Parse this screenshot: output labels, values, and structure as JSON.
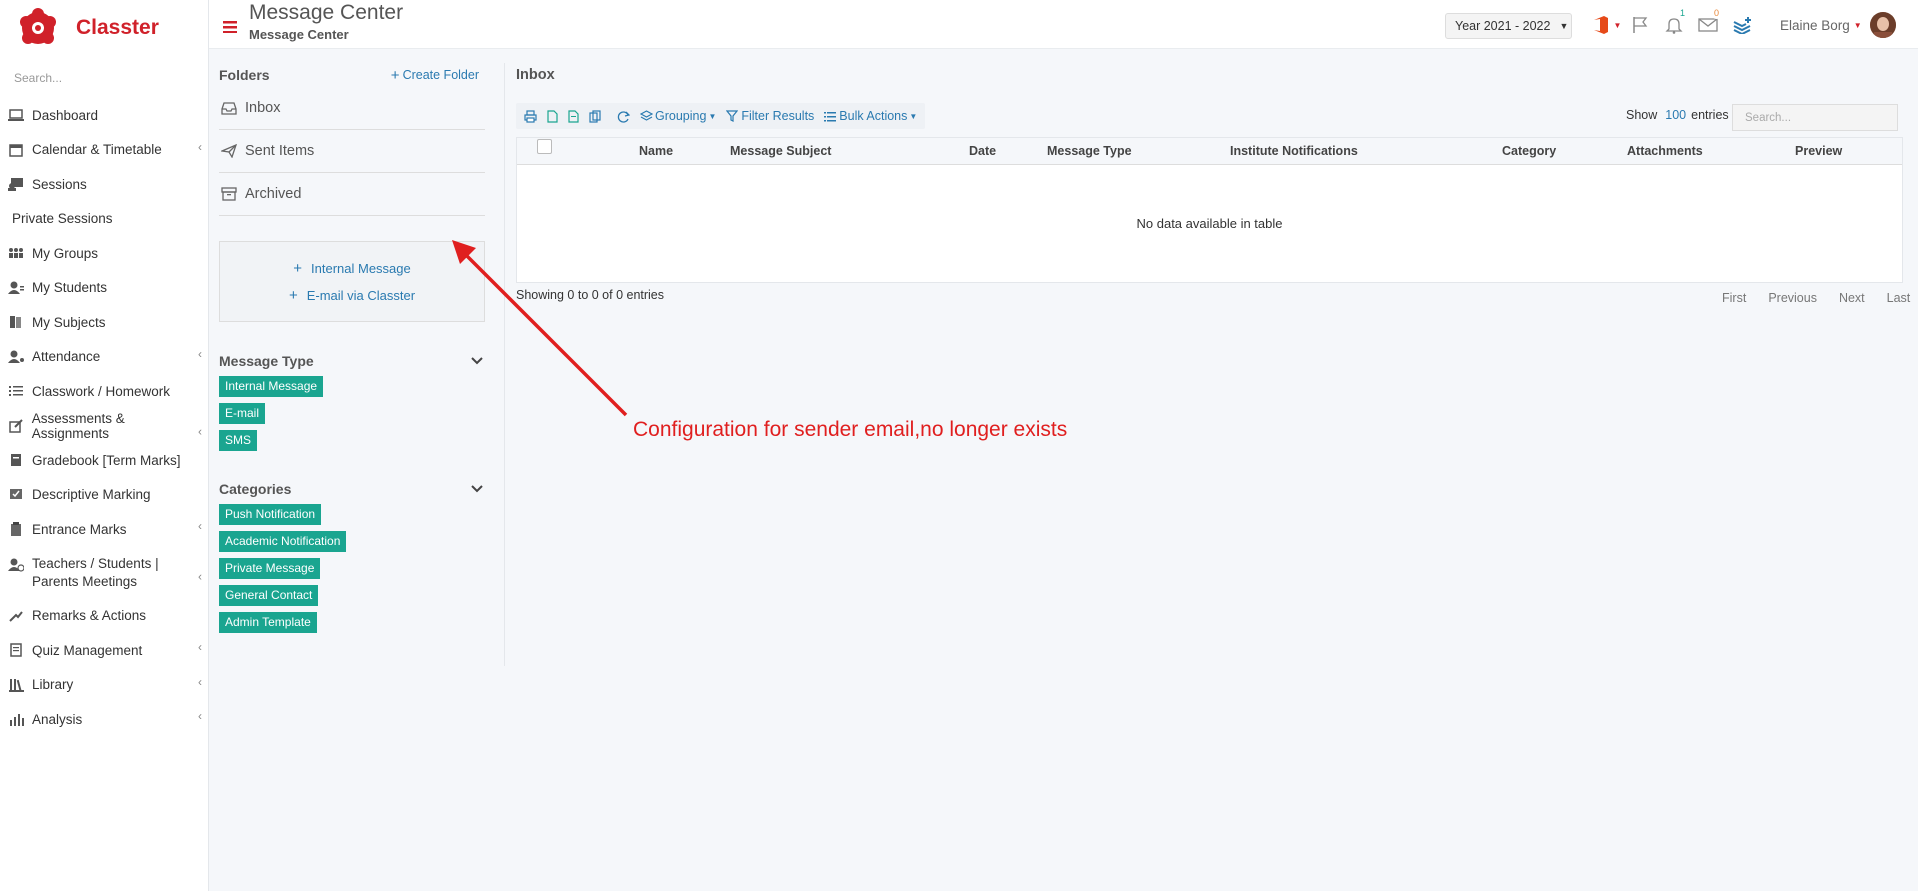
{
  "app": {
    "name": "Classter"
  },
  "sidebar": {
    "search_placeholder": "Search...",
    "items": [
      {
        "label": "Dashboard",
        "icon": "laptop-icon",
        "caret": false
      },
      {
        "label": "Calendar & Timetable",
        "icon": "calendar-icon",
        "caret": true
      },
      {
        "label": "Sessions",
        "icon": "sessions-icon",
        "caret": false
      },
      {
        "label": "Private Sessions",
        "icon": "",
        "caret": false
      },
      {
        "label": "My Groups",
        "icon": "groups-icon",
        "caret": false
      },
      {
        "label": "My Students",
        "icon": "students-icon",
        "caret": false
      },
      {
        "label": "My Subjects",
        "icon": "book-icon",
        "caret": false
      },
      {
        "label": "Attendance",
        "icon": "attendance-icon",
        "caret": true
      },
      {
        "label": "Classwork / Homework",
        "icon": "list-icon",
        "caret": false
      },
      {
        "label": "Assessments & Assignments",
        "icon": "edit-icon",
        "caret": true
      },
      {
        "label": "Gradebook [Term Marks]",
        "icon": "gradebook-icon",
        "caret": false
      },
      {
        "label": "Descriptive Marking",
        "icon": "marking-icon",
        "caret": false
      },
      {
        "label": "Entrance Marks",
        "icon": "clipboard-icon",
        "caret": true
      },
      {
        "label": "Teachers / Students | Parents Meetings",
        "icon": "meetings-icon",
        "caret": true
      },
      {
        "label": "Remarks & Actions",
        "icon": "remarks-icon",
        "caret": false
      },
      {
        "label": "Quiz Management",
        "icon": "quiz-icon",
        "caret": true
      },
      {
        "label": "Library",
        "icon": "library-icon",
        "caret": true
      },
      {
        "label": "Analysis",
        "icon": "analysis-icon",
        "caret": true
      }
    ]
  },
  "header": {
    "title": "Message Center",
    "subtitle": "Message Center",
    "year": "Year 2021 - 2022",
    "notifications_badge": "1",
    "messages_badge": "0",
    "user_name": "Elaine Borg"
  },
  "folders": {
    "title": "Folders",
    "create_label": "Create Folder",
    "items": [
      {
        "label": "Inbox",
        "icon": "inbox-icon"
      },
      {
        "label": "Sent Items",
        "icon": "send-icon"
      },
      {
        "label": "Archived",
        "icon": "archive-icon"
      }
    ],
    "compose": {
      "internal": "Internal Message",
      "email": "E-mail via Classter"
    }
  },
  "message_type": {
    "title": "Message Type",
    "tags": [
      "Internal Message",
      "E-mail",
      "SMS"
    ]
  },
  "categories": {
    "title": "Categories",
    "tags": [
      "Push Notification",
      "Academic Notification",
      "Private Message",
      "General Contact",
      "Admin Template"
    ]
  },
  "inbox": {
    "title": "Inbox",
    "toolbar": {
      "grouping": "Grouping",
      "filter": "Filter Results",
      "bulk": "Bulk Actions"
    },
    "show_label": "Show",
    "page_size": "100",
    "entries_label": "entries",
    "search_placeholder": "Search...",
    "columns": [
      "Name",
      "Message Subject",
      "Date",
      "Message Type",
      "Institute Notifications",
      "Category",
      "Attachments",
      "Preview"
    ],
    "empty_text": "No data available in table",
    "showing_text": "Showing 0 to 0 of 0 entries",
    "pager": [
      "First",
      "Previous",
      "Next",
      "Last"
    ]
  },
  "annotation": {
    "text": "Configuration for sender email,no longer exists",
    "color": "#e01f1f"
  },
  "colors": {
    "brand": "#d0212a",
    "link": "#2a7ab0",
    "tag": "#1aa590"
  }
}
